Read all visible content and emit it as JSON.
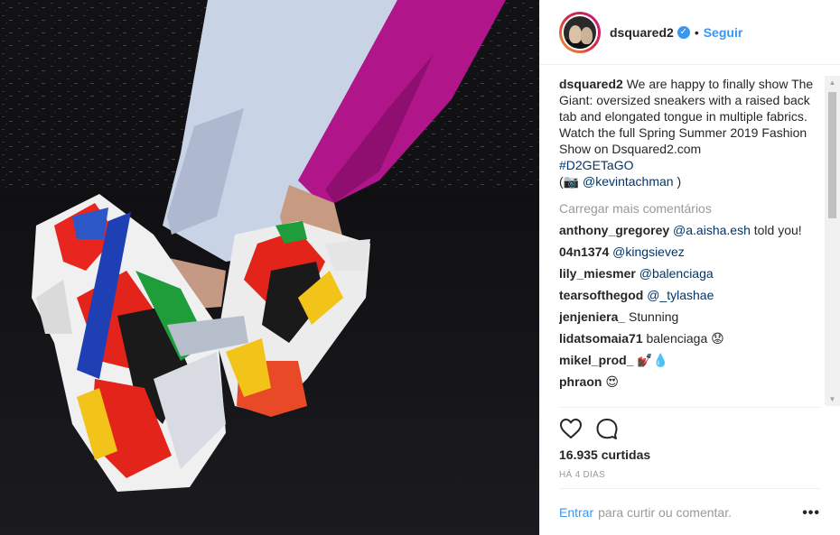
{
  "post": {
    "username": "dsquared2",
    "verified_icon": "verified-badge-icon",
    "separator": "•",
    "follow_label": "Seguir",
    "caption": {
      "username": "dsquared2",
      "line1": "We are happy to finally show The Giant: oversized sneakers with a raised back tab and elongated tongue in multiple fabrics.",
      "line2": "Watch the full Spring Summer 2019 Fashion Show on Dsquared2.com",
      "hashtag": "#D2GETaGO",
      "credit_open": "(📷 ",
      "credit_user": "@kevintachman",
      "credit_close": " )"
    },
    "load_more": "Carregar mais comentários",
    "comments": [
      {
        "user": "anthony_gregorey",
        "mention": "@a.aisha.esh",
        "text": " told you!"
      },
      {
        "user": "04n1374",
        "mention": "@kingsievez",
        "text": ""
      },
      {
        "user": "lily_miesmer",
        "mention": "@balenciaga",
        "text": ""
      },
      {
        "user": "tearsofthegod",
        "mention": "@_tylashae",
        "text": ""
      },
      {
        "user": "jenjeniera_",
        "mention": "",
        "text": "Stunning"
      },
      {
        "user": "lidatsomaia71",
        "mention": "",
        "text": "balenciaga 😟"
      },
      {
        "user": "mikel_prod_",
        "mention": "",
        "text": "💅🏿💧"
      },
      {
        "user": "phraon",
        "mention": "",
        "text": "😍"
      }
    ],
    "likes": "16.935 curtidas",
    "time": "HÁ 4 DIAS",
    "login": {
      "enter": "Entrar",
      "rest": "para curtir ou comentar."
    },
    "more_label": "•••"
  },
  "colors": {
    "link": "#003569",
    "accent": "#3897f0",
    "muted": "#999999"
  }
}
